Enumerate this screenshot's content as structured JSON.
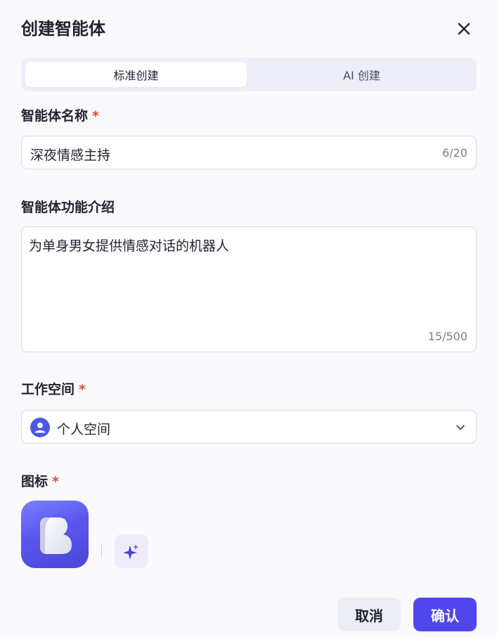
{
  "dialog": {
    "title": "创建智能体"
  },
  "tabs": [
    {
      "label": "标准创建",
      "active": true
    },
    {
      "label": "AI 创建",
      "active": false
    }
  ],
  "name_field": {
    "label": "智能体名称",
    "required_mark": "*",
    "value": "深夜情感主持",
    "counter": "6/20"
  },
  "description_field": {
    "label": "智能体功能介绍",
    "value": "为单身男女提供情感对话的机器人",
    "counter": "15/500"
  },
  "workspace_field": {
    "label": "工作空间",
    "required_mark": "*",
    "value": "个人空间",
    "avatar_icon": "user-icon",
    "dropdown_icon": "chevron-down-icon"
  },
  "icon_field": {
    "label": "图标",
    "required_mark": "*",
    "app_icon": "bot-b-icon",
    "generate_icon": "sparkle-icon"
  },
  "footer": {
    "cancel_label": "取消",
    "confirm_label": "确认"
  },
  "colors": {
    "accent": "#5146ee",
    "required": "#e0472d",
    "background": "#fafafc"
  }
}
